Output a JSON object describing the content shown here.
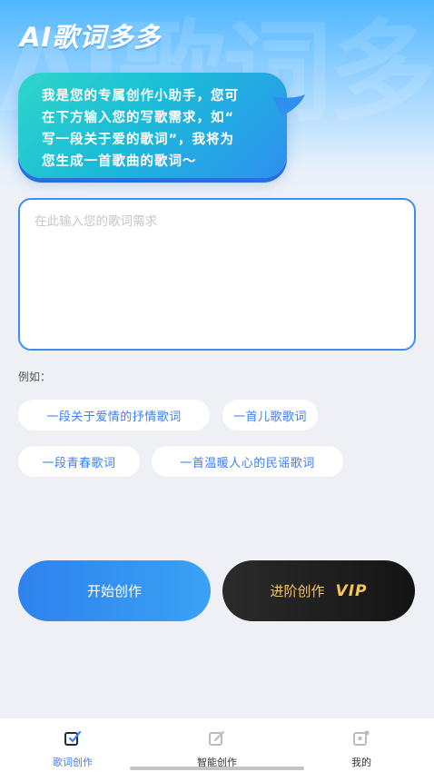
{
  "header": {
    "app_title": "AI歌词多多"
  },
  "assistant_bubble": {
    "lines": [
      "我是您的专属创作小助手，您可",
      "在下方输入您的写歌需求，如“",
      "写一段关于爱的歌词”，我将为",
      "您生成一首歌曲的歌词～"
    ]
  },
  "lyric_input": {
    "placeholder": "在此输入您的歌词需求",
    "value": ""
  },
  "examples": {
    "label": "例如：",
    "chips": [
      "一段关于爱情的抒情歌词",
      "一首儿歌歌词",
      "一段青春歌词",
      "一首温暖人心的民谣歌词"
    ]
  },
  "actions": {
    "start_label": "开始创作",
    "advanced_label": "进阶创作",
    "vip_badge": "VIP"
  },
  "tabbar": {
    "items": [
      {
        "label": "歌词创作",
        "icon": "lyrics-edit-icon",
        "active": true
      },
      {
        "label": "智能创作",
        "icon": "smart-edit-icon",
        "active": false
      },
      {
        "label": "我的",
        "icon": "profile-icon",
        "active": false
      }
    ]
  },
  "colors": {
    "accent": "#3d7ff0",
    "bubble_start": "#2fd6c9",
    "bubble_end": "#2f8ff0",
    "vip_gold": "#f5c36a",
    "dark_button": "#1c1c1c"
  }
}
